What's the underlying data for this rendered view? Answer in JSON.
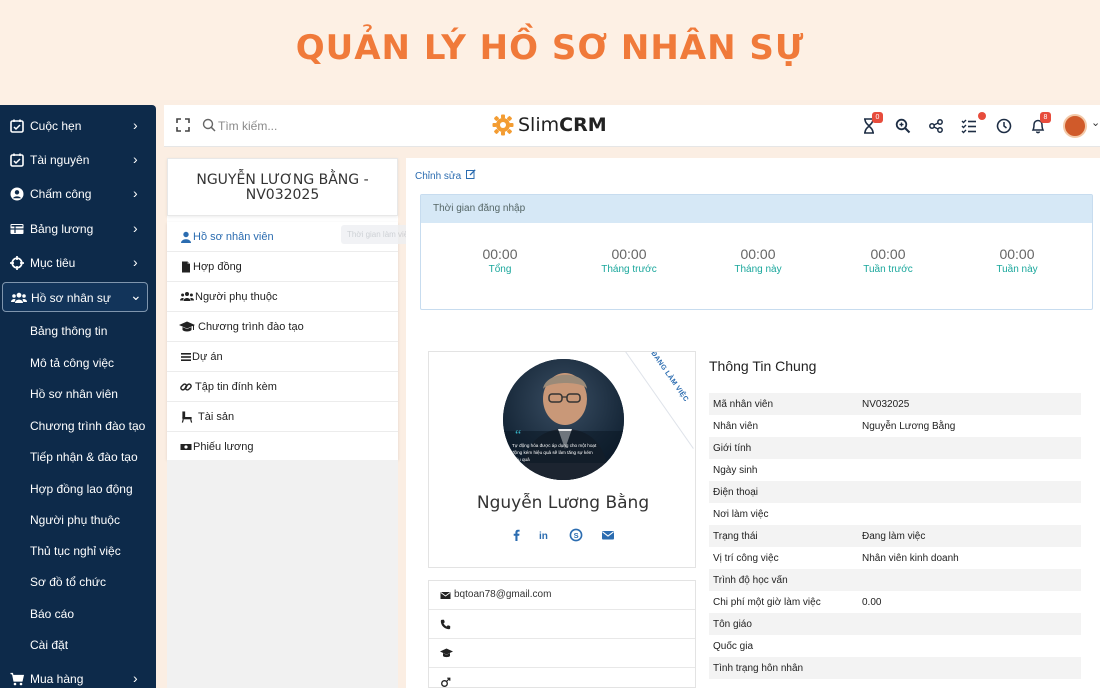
{
  "banner": {
    "title": "QUẢN LÝ HỒ SƠ NHÂN SỰ"
  },
  "colors": {
    "accent": "#f07a3a",
    "sidebar": "#0d2a4a",
    "link": "#2b6cb0",
    "teal": "#1aa79c",
    "badge": "#e74c3c"
  },
  "sidebar": {
    "items": [
      {
        "label": "Cuộc hẹn",
        "icon": "calendar-check-icon"
      },
      {
        "label": "Tài nguyên",
        "icon": "calendar-check-icon"
      },
      {
        "label": "Chấm công",
        "icon": "user-circle-icon"
      },
      {
        "label": "Bảng lương",
        "icon": "table-icon"
      },
      {
        "label": "Mục tiêu",
        "icon": "crosshairs-icon"
      },
      {
        "label": "Hồ sơ nhân sự",
        "icon": "users-icon"
      },
      {
        "label": "Mua hàng",
        "icon": "shopping-cart-icon"
      }
    ],
    "sub_items": [
      "Bảng thông tin",
      "Mô tả công việc",
      "Hồ sơ nhân viên",
      "Chương trình đào tạo",
      "Tiếp nhận & đào tạo",
      "Hợp đồng lao động",
      "Người phụ thuộc",
      "Thủ tục nghỉ việc",
      "Sơ đồ tổ chức",
      "Báo cáo",
      "Cài đặt"
    ]
  },
  "topbar": {
    "search_placeholder": "Tìm kiếm...",
    "logo_slim": "Slim",
    "logo_crm": "CRM",
    "badge_timer": "0",
    "badge_notifications": "8"
  },
  "employee": {
    "title": "NGUYỄN LƯƠNG BẰNG - NV032025"
  },
  "menu": {
    "items": [
      {
        "label": "Hồ sơ nhân viên",
        "icon": "user-icon"
      },
      {
        "label": "Hợp đồng",
        "icon": "file-icon"
      },
      {
        "label": "Người phụ thuộc",
        "icon": "users-icon"
      },
      {
        "label": "Chương trình đào tạo",
        "icon": "graduation-cap-icon"
      },
      {
        "label": "Dự án",
        "icon": "list-icon"
      },
      {
        "label": "Tập tin đính kèm",
        "icon": "link-icon"
      },
      {
        "label": "Tài sản",
        "icon": "chair-icon"
      },
      {
        "label": "Phiếu lương",
        "icon": "money-icon"
      }
    ],
    "tooltip": "Thời gian làm việc"
  },
  "main": {
    "edit_label": "Chỉnh sửa",
    "login_header": "Thời gian đăng nhập",
    "stats": [
      {
        "value": "00:00",
        "label": "Tổng"
      },
      {
        "value": "00:00",
        "label": "Tháng trước"
      },
      {
        "value": "00:00",
        "label": "Tháng này"
      },
      {
        "value": "00:00",
        "label": "Tuần trước"
      },
      {
        "value": "00:00",
        "label": "Tuần này"
      }
    ]
  },
  "profile": {
    "ribbon": "ĐANG LÀM VIỆC",
    "name": "Nguyễn Lương Bằng",
    "photo_quote_1": "Tự động hóa được áp dụng cho một hoạt",
    "photo_quote_2": "động kém hiệu quả sẽ làm tăng sự kém",
    "photo_quote_3": "hiệu quả",
    "email": "bqtoan78@gmail.com",
    "phone": "",
    "education": "",
    "gender": ""
  },
  "info": {
    "title": "Thông Tin Chung",
    "rows": [
      {
        "k": "Mã nhân viên",
        "v": "NV032025"
      },
      {
        "k": "Nhân viên",
        "v": "Nguyễn Lương Bằng"
      },
      {
        "k": "Giới tính",
        "v": ""
      },
      {
        "k": "Ngày sinh",
        "v": ""
      },
      {
        "k": "Điện thoại",
        "v": ""
      },
      {
        "k": "Nơi làm việc",
        "v": ""
      },
      {
        "k": "Trạng thái",
        "v": "Đang làm việc"
      },
      {
        "k": "Vị trí công việc",
        "v": "Nhân viên kinh doanh"
      },
      {
        "k": "Trình độ học vấn",
        "v": ""
      },
      {
        "k": "Chi phí một giờ làm việc",
        "v": "0.00"
      },
      {
        "k": "Tôn giáo",
        "v": ""
      },
      {
        "k": "Quốc gia",
        "v": ""
      },
      {
        "k": "Tình trạng hôn nhân",
        "v": ""
      }
    ]
  }
}
